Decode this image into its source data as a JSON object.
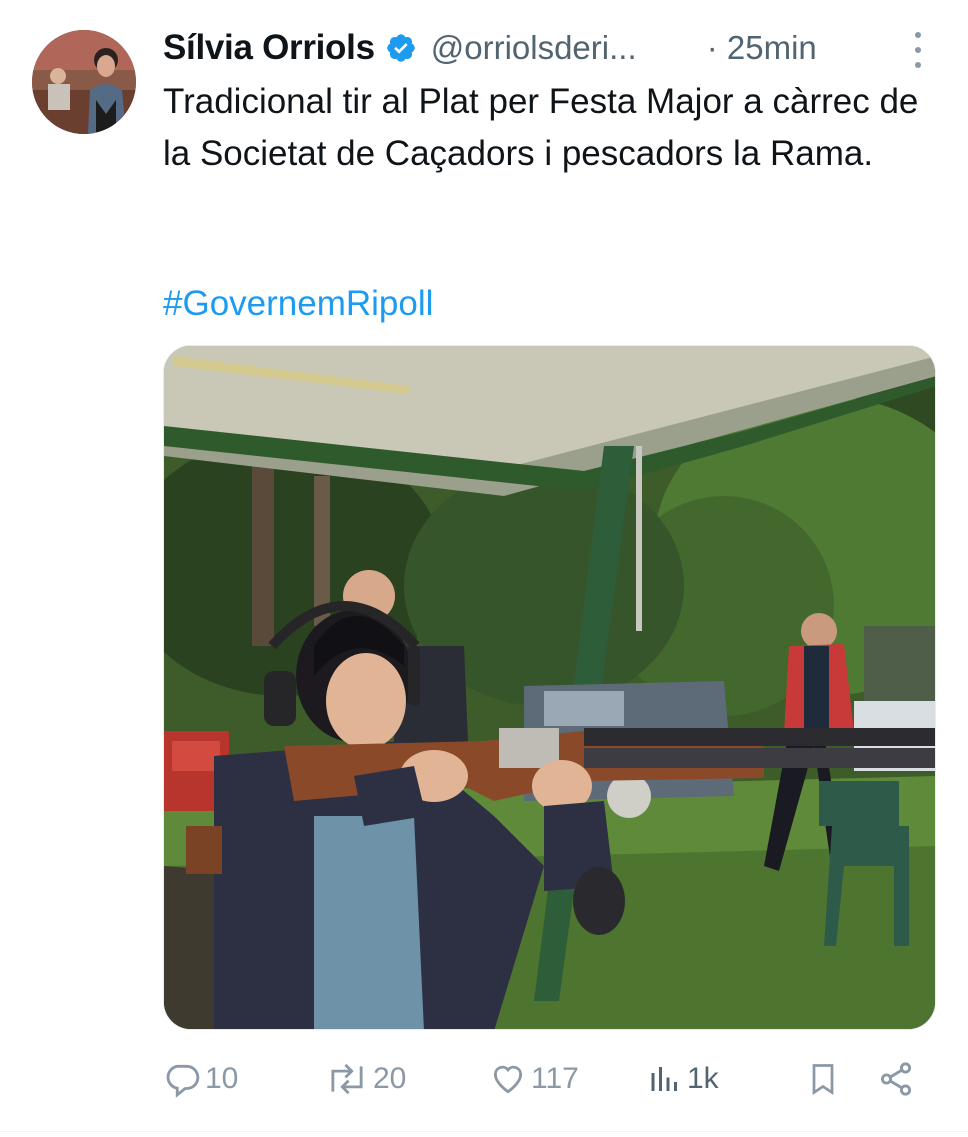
{
  "tweet": {
    "author_name": "Sílvia Orriols",
    "handle": "@orriolsderi...",
    "time": "· 25min",
    "text": "Tradicional tir al Plat per Festa Major a càrrec de la Societat de Caçadors i pescadors la Rama.",
    "hashtag": "#GovernemRipoll"
  },
  "actions": {
    "replies": "10",
    "retweets": "20",
    "likes": "117",
    "views": "1k"
  },
  "colors": {
    "accent": "#1d9bf0",
    "secondary_text": "#536471",
    "icon_gray": "#8b98a5"
  },
  "icons": {
    "verified": "verified-badge-icon",
    "more": "more-vertical-icon",
    "reply": "reply-bubble-icon",
    "retweet": "retweet-icon",
    "like": "heart-icon",
    "views": "views-bar-icon",
    "bookmark": "bookmark-icon",
    "share": "share-icon"
  }
}
